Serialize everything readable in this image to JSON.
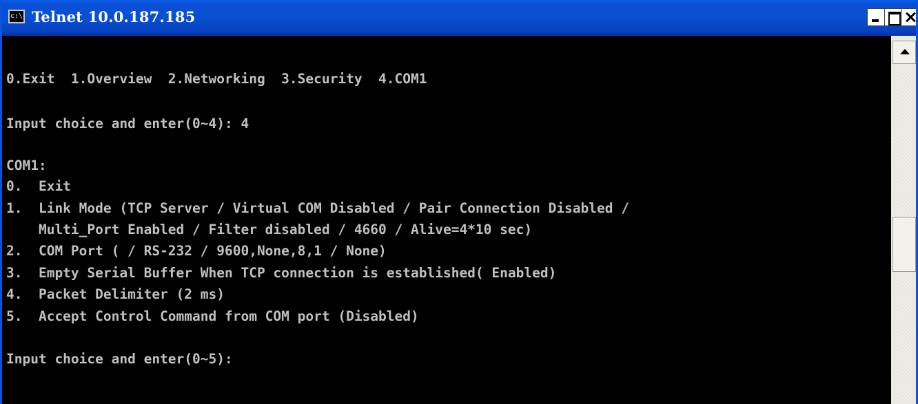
{
  "window": {
    "title": "Telnet 10.0.187.185",
    "app_icon_text": "c:\\"
  },
  "console": {
    "lines": [
      "",
      "0.Exit  1.Overview  2.Networking  3.Security  4.COM1",
      "",
      "Input choice and enter(0~4): 4",
      "",
      "COM1:",
      "0.  Exit",
      "1.  Link Mode (TCP Server / Virtual COM Disabled / Pair Connection Disabled /",
      "    Multi_Port Enabled / Filter disabled / 4660 / Alive=4*10 sec)",
      "2.  COM Port ( / RS-232 / 9600,None,8,1 / None)",
      "3.  Empty Serial Buffer When TCP connection is established( Enabled)",
      "4.  Packet Delimiter (2 ms)",
      "5.  Accept Control Command from COM port (Disabled)",
      "",
      "Input choice and enter(0~5):"
    ]
  },
  "colors": {
    "titlebar": "#0850d2",
    "console_bg": "#000000",
    "console_text": "#c0c0c0"
  },
  "icons": {
    "app": "console-icon",
    "minimize": "minimize-icon",
    "maximize": "maximize-icon",
    "close": "close-icon",
    "scroll_up": "scroll-up-arrow-icon"
  }
}
